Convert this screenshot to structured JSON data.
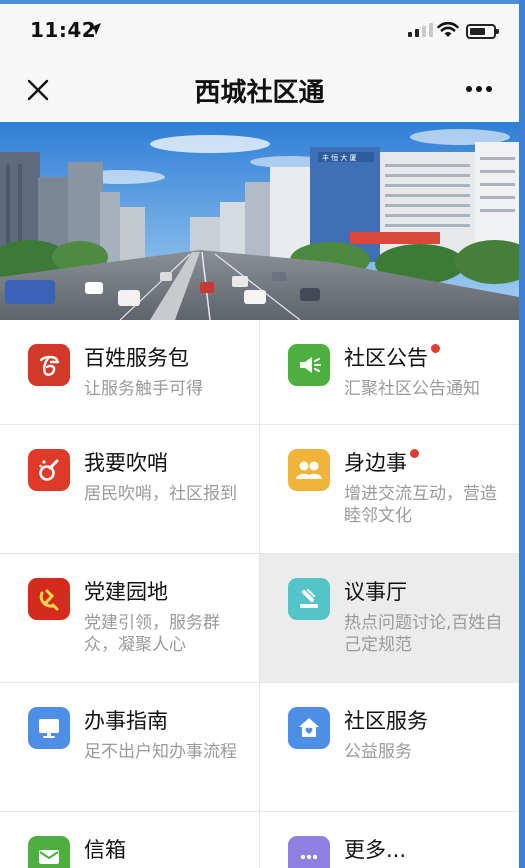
{
  "status_bar": {
    "time": "11:42"
  },
  "nav": {
    "title": "西城社区通"
  },
  "banner": {
    "building_sign": "丰 恒 大 厦"
  },
  "grid": {
    "items": [
      {
        "title": "百姓服务包",
        "desc": "让服务触手可得",
        "icon": "service-package-icon",
        "color": "#d13a2a",
        "badge": false
      },
      {
        "title": "社区公告",
        "desc": "汇聚社区公告通知",
        "icon": "megaphone-icon",
        "color": "#4caf3f",
        "badge": true
      },
      {
        "title": "我要吹哨",
        "desc": "居民吹哨，社区报到",
        "icon": "whistle-icon",
        "color": "#dd3b28",
        "badge": false
      },
      {
        "title": "身边事",
        "desc": "增进交流互动，营造睦邻文化",
        "icon": "people-icon",
        "color": "#f1b43b",
        "badge": true
      },
      {
        "title": "党建园地",
        "desc": "党建引领，服务群众，凝聚人心",
        "icon": "party-emblem-icon",
        "color": "#d42b1f",
        "badge": false
      },
      {
        "title": "议事厅",
        "desc": "热点问题讨论,百姓自己定规范",
        "icon": "gavel-icon",
        "color": "#54c4c9",
        "badge": false
      },
      {
        "title": "办事指南",
        "desc": "足不出户知办事流程",
        "icon": "monitor-icon",
        "color": "#4d8fe6",
        "badge": false
      },
      {
        "title": "社区服务",
        "desc": "公益服务",
        "icon": "home-service-icon",
        "color": "#4d8fe6",
        "badge": false
      },
      {
        "title": "信箱",
        "desc": "",
        "icon": "mail-icon",
        "color": "#4caf3f",
        "badge": false
      },
      {
        "title": "更多...",
        "desc": "",
        "icon": "more-icon",
        "color": "#8f7fe0",
        "badge": false
      }
    ]
  }
}
